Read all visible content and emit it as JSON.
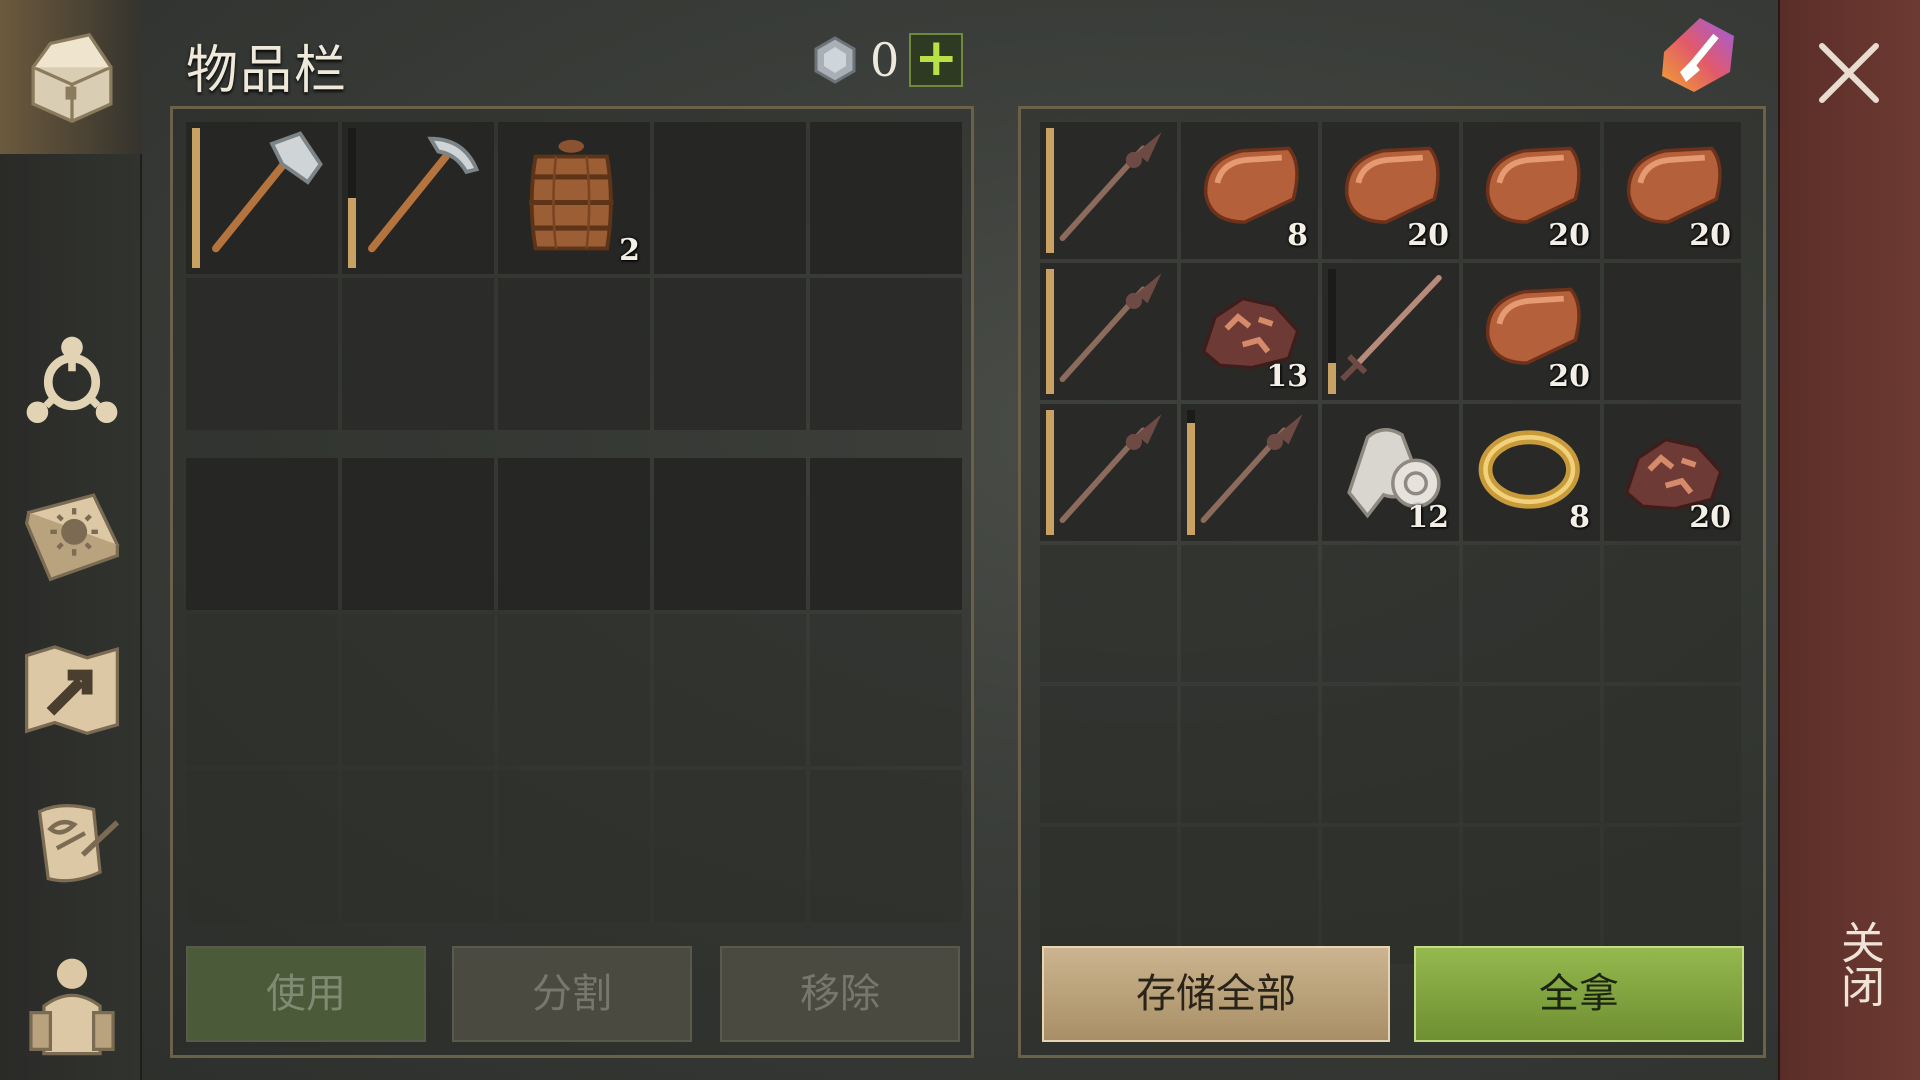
{
  "header": {
    "title": "物品栏",
    "currency_value": "0",
    "currency_icon": "gem-coin-icon",
    "plus_label": "+"
  },
  "sidebar": {
    "items": [
      {
        "name": "chest-icon",
        "active": true
      },
      {
        "name": "skills-tree-icon"
      },
      {
        "name": "book-sun-icon"
      },
      {
        "name": "map-arrow-icon"
      },
      {
        "name": "scroll-quill-icon"
      },
      {
        "name": "character-backpack-icon"
      }
    ]
  },
  "inventory": {
    "slots": [
      {
        "item": "axe",
        "durability": 1.0
      },
      {
        "item": "pickaxe",
        "durability": 0.5
      },
      {
        "item": "barrel",
        "qty": "2"
      },
      {},
      {},
      {},
      {},
      {},
      {},
      {}
    ],
    "lower_slots_count": 15
  },
  "container": {
    "slots": [
      {
        "item": "spear",
        "durability": 1.0
      },
      {
        "item": "copper-ingot",
        "qty": "8"
      },
      {
        "item": "copper-ingot",
        "qty": "20"
      },
      {
        "item": "copper-ingot",
        "qty": "20"
      },
      {
        "item": "copper-ingot",
        "qty": "20"
      },
      {
        "item": "spear",
        "durability": 1.0
      },
      {
        "item": "copper-ore",
        "qty": "13"
      },
      {
        "item": "sword",
        "durability": 0.25
      },
      {
        "item": "copper-ingot",
        "qty": "20"
      },
      {},
      {
        "item": "spear",
        "durability": 1.0
      },
      {
        "item": "spear",
        "durability": 0.9
      },
      {
        "item": "cloth-roll",
        "qty": "12"
      },
      {
        "item": "gold-ring",
        "qty": "8"
      },
      {
        "item": "copper-ore",
        "qty": "20"
      }
    ],
    "empty_rows": 3
  },
  "buttons": {
    "use": "使用",
    "split": "分割",
    "remove": "移除",
    "store_all": "存储全部",
    "take_all": "全拿"
  },
  "close": {
    "label": "关闭"
  },
  "colors": {
    "accent_green": "#8fb14a",
    "accent_tan": "#c2aa80",
    "durability": "#c9a263"
  }
}
